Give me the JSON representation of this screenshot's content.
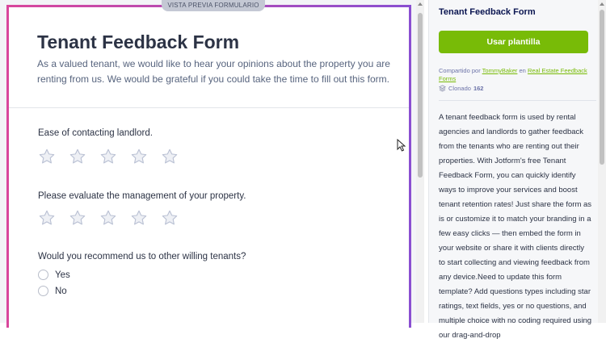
{
  "preview": {
    "tag": "VISTA PREVIA FORMULARIO",
    "form_title": "Tenant Feedback Form",
    "form_subtitle": "As a valued tenant, we would like to hear your opinions about the property you are renting from us. We would be grateful if you could take the time to fill out this form.",
    "questions": [
      {
        "label": "Ease of contacting landlord.",
        "type": "star-rating",
        "rating": 0,
        "max": 5
      },
      {
        "label": "Please evaluate the management of your property.",
        "type": "star-rating",
        "rating": 0,
        "max": 5
      },
      {
        "label": "Would you recommend us to other willing tenants?",
        "type": "radio",
        "options": [
          "Yes",
          "No"
        ]
      }
    ]
  },
  "sidebar": {
    "title": "Tenant Feedback Form",
    "use_button": "Usar plantilla",
    "shared_prefix": "Compartido por",
    "shared_author": "TommyBaker",
    "shared_in": "en",
    "category": "Real Estate Feedback Forms",
    "cloned_label": "Clonado",
    "cloned_count": "162",
    "description": "A tenant feedback form is used by rental agencies and landlords to gather feedback from the tenants who are renting out their properties. With Jotform's free Tenant Feedback Form, you can quickly identify ways to improve your services and boost tenant retention rates! Just share the form as is or customize it to match your branding in a few easy clicks — then embed the form in your website or share it with clients directly to start collecting and viewing feedback from any device.Need to update this form template? Add questions types including star ratings, text fields, yes or no questions, and multiple choice with no coding required using our drag-and-drop"
  },
  "colors": {
    "accent_green": "#78bb07",
    "frame_gradient_start": "#d9479c",
    "frame_gradient_end": "#8a4fd1",
    "title_navy": "#0a1551"
  }
}
